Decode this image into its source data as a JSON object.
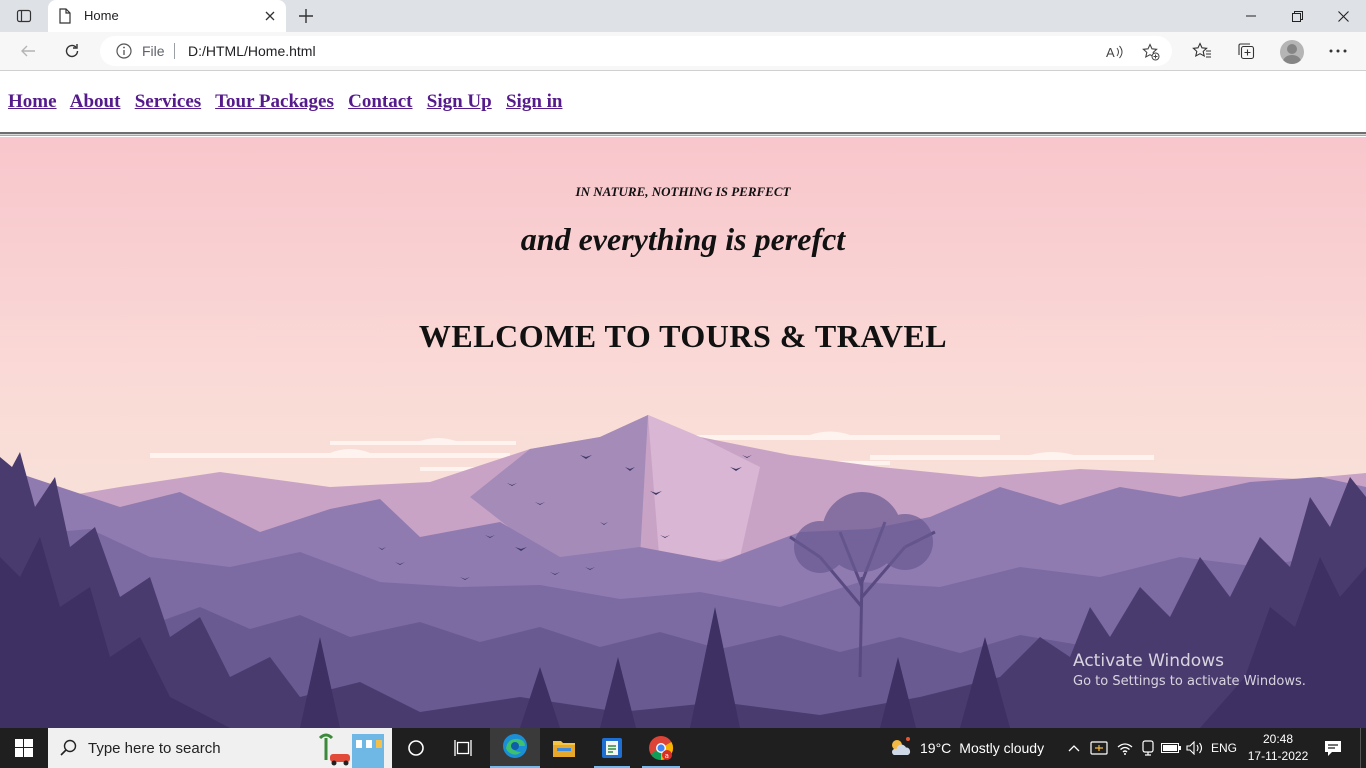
{
  "browser": {
    "tab_title": "Home",
    "address_scheme": "File",
    "address_url": "D:/HTML/Home.html"
  },
  "site": {
    "nav": [
      {
        "label": "Home"
      },
      {
        "label": "About"
      },
      {
        "label": "Services"
      },
      {
        "label": "Tour Packages"
      },
      {
        "label": "Contact"
      },
      {
        "label": "Sign Up"
      },
      {
        "label": "Sign in"
      }
    ],
    "kicker": "IN NATURE, NOTHING IS PERFECT",
    "tagline": "and everything is perefct",
    "welcome": "WELCOME TO TOURS & TRAVEL"
  },
  "watermark": {
    "line1": "Activate Windows",
    "line2": "Go to Settings to activate Windows."
  },
  "taskbar": {
    "search_placeholder": "Type here to search",
    "weather_temp": "19°C",
    "weather_text": "Mostly cloudy",
    "language": "ENG",
    "time": "20:48",
    "date": "17-11-2022"
  },
  "colors": {
    "link_visited": "#551a8b",
    "taskbar_bg": "#1f1f1f",
    "tab_strip_bg": "#dee1e6"
  },
  "icons": [
    "tab-actions-icon",
    "page-icon",
    "close-icon",
    "plus-icon",
    "minimize-icon",
    "restore-icon",
    "back-icon",
    "refresh-icon",
    "info-icon",
    "read-aloud-icon",
    "add-favorite-icon",
    "favorites-icon",
    "collections-icon",
    "profile-icon",
    "more-icon",
    "windows-start-icon",
    "search-icon",
    "cortana-icon",
    "task-view-icon",
    "edge-icon",
    "file-explorer-icon",
    "app-icon",
    "chrome-icon",
    "weather-icon",
    "chevron-up-icon",
    "network-icon",
    "wifi-icon",
    "battery-icon",
    "volume-icon",
    "notifications-icon"
  ]
}
